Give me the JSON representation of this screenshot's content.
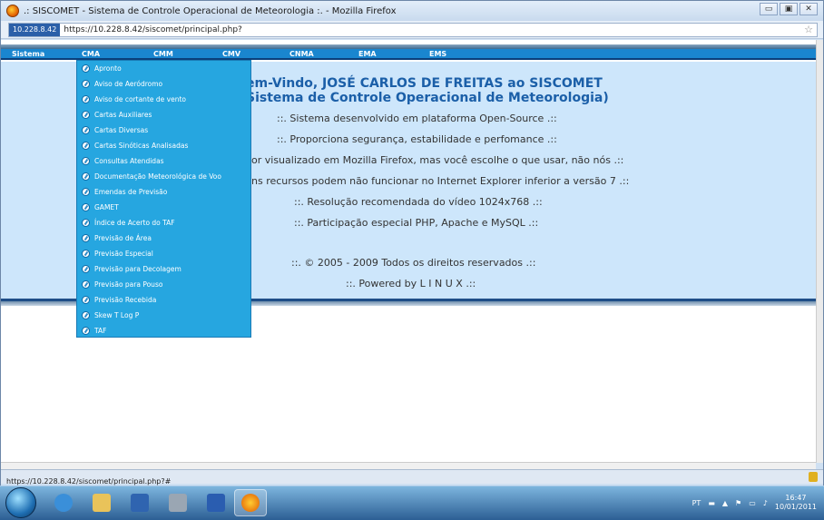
{
  "window": {
    "title": ".: SISCOMET - Sistema de Controle Operacional de Meteorologia :. - Mozilla Firefox",
    "minimize": "▭",
    "maximize": "▣",
    "close": "✕"
  },
  "address": {
    "site_id": "10.228.8.42",
    "url": "https://10.228.8.42/siscomet/principal.php?"
  },
  "menu": {
    "items": [
      "Sistema",
      "CMA",
      "CMM",
      "CMV",
      "CNMA",
      "EMA",
      "EMS"
    ]
  },
  "welcome": {
    "line1": "em-Vindo, JOSÉ CARLOS DE FREITAS ao SISCOMET",
    "line2": "Sistema de Controle Operacional de Meteorologia)"
  },
  "info": [
    "::. Sistema desenvolvido em plataforma Open-Source .::",
    "::. Proporciona segurança, estabilidade e perfomance .::",
    "or visualizado em Mozilla Firefox, mas você escolhe o que usar, não nós .::",
    "ns recursos podem não funcionar no Internet Explorer inferior a versão 7 .::",
    "::. Resolução recomendada do vídeo 1024x768 .::",
    "::. Participação especial PHP, Apache e MySQL .::",
    "::. © 2005 - 2009 Todos os direitos reservados .::",
    "::. Powered by L I N U X .::"
  ],
  "dropdown": {
    "items": [
      "Apronto",
      "Aviso de Aeródromo",
      "Aviso de cortante de vento",
      "Cartas Auxiliares",
      "Cartas Diversas",
      "Cartas Sinóticas Analisadas",
      "Consultas Atendidas",
      "Documentação Meteorológica de Voo",
      "Emendas de Previsão",
      "GAMET",
      "Índice de Acerto do TAF",
      "Previsão de Área",
      "Previsão Especial",
      "Previsão para Decolagem",
      "Previsão para Pouso",
      "Previsão Recebida",
      "Skew T Log P",
      "TAF"
    ]
  },
  "status": {
    "text": "https://10.228.8.42/siscomet/principal.php?#"
  },
  "taskbar": {
    "lang": "PT",
    "time": "16:47",
    "date": "10/01/2011"
  }
}
